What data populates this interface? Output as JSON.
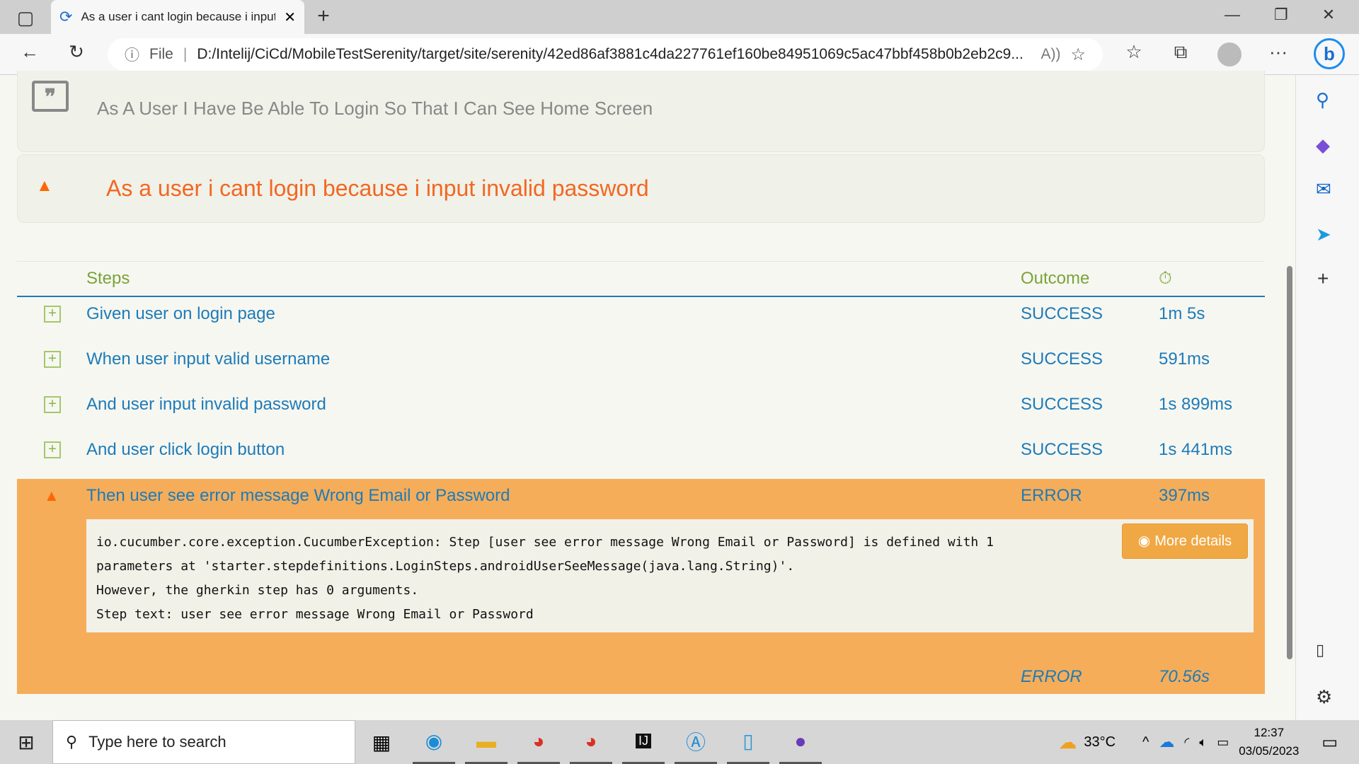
{
  "browser": {
    "tab_title": "As a user i cant login because i input invalid password",
    "url_scheme": "File",
    "url": "D:/Intelij/CiCd/MobileTestSerenity/target/site/serenity/42ed86af3881c4da227761ef160be84951069c5ac47bbf458b0b2eb2c9..."
  },
  "narrative": "As A User I Have Be Able To Login So That I Can See Home Screen",
  "scenario_title": "As a user i cant login because i input invalid password",
  "table": {
    "headers": {
      "steps": "Steps",
      "outcome": "Outcome"
    },
    "rows": [
      {
        "step": "Given user on login page",
        "outcome": "SUCCESS",
        "duration": "1m 5s"
      },
      {
        "step": "When user input valid username",
        "outcome": "SUCCESS",
        "duration": "591ms"
      },
      {
        "step": "And user input invalid password",
        "outcome": "SUCCESS",
        "duration": "1s 899ms"
      },
      {
        "step": "And user click login button",
        "outcome": "SUCCESS",
        "duration": "1s 441ms"
      }
    ],
    "error_row": {
      "step": "Then user see error message Wrong Email or Password",
      "outcome": "ERROR",
      "duration": "397ms",
      "exception": [
        "io.cucumber.core.exception.CucumberException: Step [user see error message Wrong Email or Password] is defined with 1",
        "parameters at 'starter.stepdefinitions.LoginSteps.androidUserSeeMessage(java.lang.String)'.",
        "However, the gherkin step has 0 arguments.",
        "Step text: user see error message Wrong Email or Password"
      ],
      "more_details": "More details"
    },
    "footer": {
      "outcome": "ERROR",
      "duration": "70.56s"
    }
  },
  "taskbar": {
    "search_placeholder": "Type here to search",
    "weather": "33°C",
    "time": "12:37",
    "date": "03/05/2023"
  },
  "colors": {
    "error_bg": "#f5ad5a",
    "link": "#1e7bb8",
    "header": "#7aa33a",
    "scenario_title": "#f26722"
  }
}
